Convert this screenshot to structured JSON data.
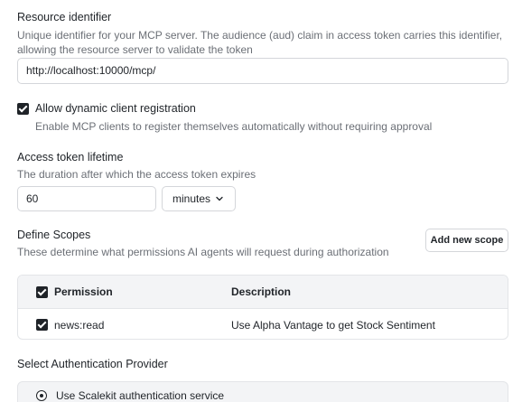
{
  "resource": {
    "label": "Resource identifier",
    "help": "Unique identifier for your MCP server. The audience (aud) claim in access token carries this identifier, allowing the resource server to validate the token",
    "value": "http://localhost:10000/mcp/"
  },
  "dcr": {
    "label": "Allow dynamic client registration",
    "help": "Enable MCP clients to register themselves automatically without requiring approval",
    "checked": true
  },
  "token": {
    "label": "Access token lifetime",
    "help": "The duration after which the access token expires",
    "value": "60",
    "unit": "minutes"
  },
  "scopes": {
    "label": "Define Scopes",
    "help": "These determine what permissions AI agents will request during authorization",
    "add_button": "Add new scope",
    "columns": {
      "permission": "Permission",
      "description": "Description"
    },
    "rows": [
      {
        "permission": "news:read",
        "description": "Use Alpha Vantage to get Stock Sentiment"
      }
    ]
  },
  "provider": {
    "label": "Select Authentication Provider",
    "option": "Use Scalekit authentication service"
  }
}
